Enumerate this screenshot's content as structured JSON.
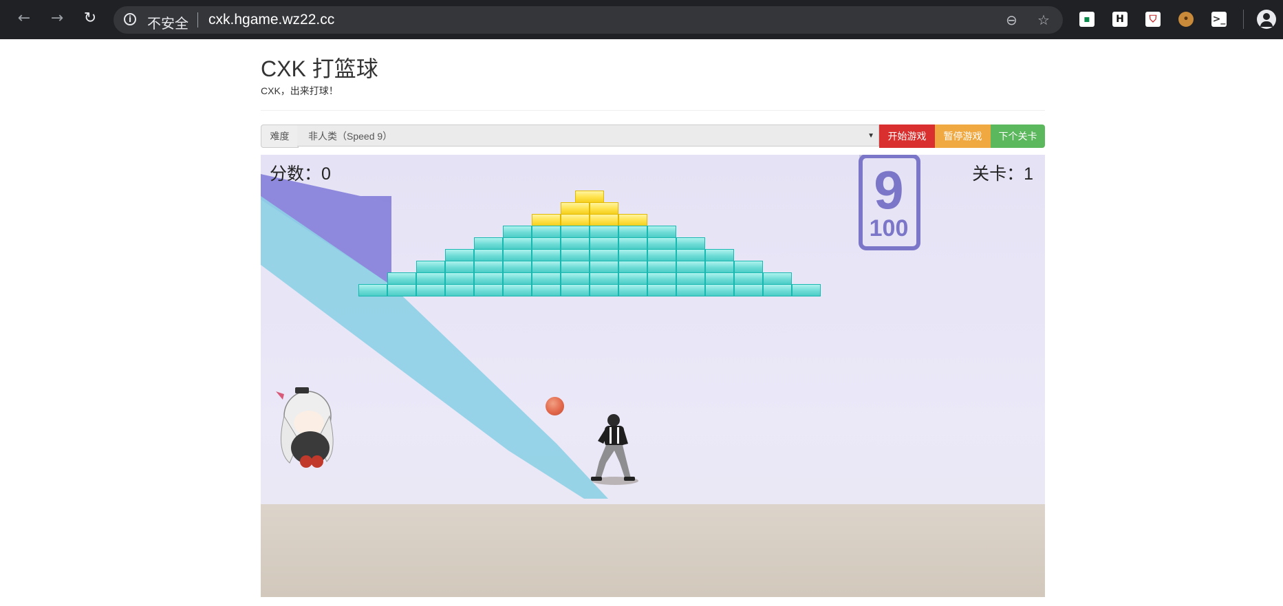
{
  "browser": {
    "back_icon": "arrow-left-icon",
    "forward_icon": "arrow-right-icon",
    "reload_icon": "reload-icon",
    "security_label": "不安全",
    "url": "cxk.hgame.wz22.cc",
    "zoom_icon": "zoom-out-icon",
    "bookmark_icon": "star-icon",
    "extensions": [
      "green-extension-icon",
      "h-extension-icon",
      "shield-extension-icon",
      "cookie-extension-icon",
      "terminal-extension-icon"
    ],
    "profile_icon": "profile-icon"
  },
  "page": {
    "title": "CXK 打篮球",
    "subtitle": "CXK，出来打球！"
  },
  "controls": {
    "difficulty_label": "难度",
    "difficulty_selected": "非人类（Speed 9）",
    "start_label": "开始游戏",
    "pause_label": "暂停游戏",
    "next_label": "下个关卡",
    "colors": {
      "start": "#d9302f",
      "pause": "#f0a840",
      "next": "#5cb85c"
    }
  },
  "game": {
    "score_text": "分数：0",
    "level_text": "关卡：1",
    "wall_number": "9",
    "wall_subnumber": "100",
    "brick_rows": [
      {
        "gold": 1,
        "teal": 0
      },
      {
        "gold": 2,
        "teal": 0
      },
      {
        "gold": 4,
        "teal": 0
      },
      {
        "gold": 0,
        "teal": 6
      },
      {
        "gold": 0,
        "teal": 8
      },
      {
        "gold": 0,
        "teal": 10
      },
      {
        "gold": 0,
        "teal": 12
      },
      {
        "gold": 0,
        "teal": 14
      },
      {
        "gold": 0,
        "teal": 16
      }
    ]
  }
}
